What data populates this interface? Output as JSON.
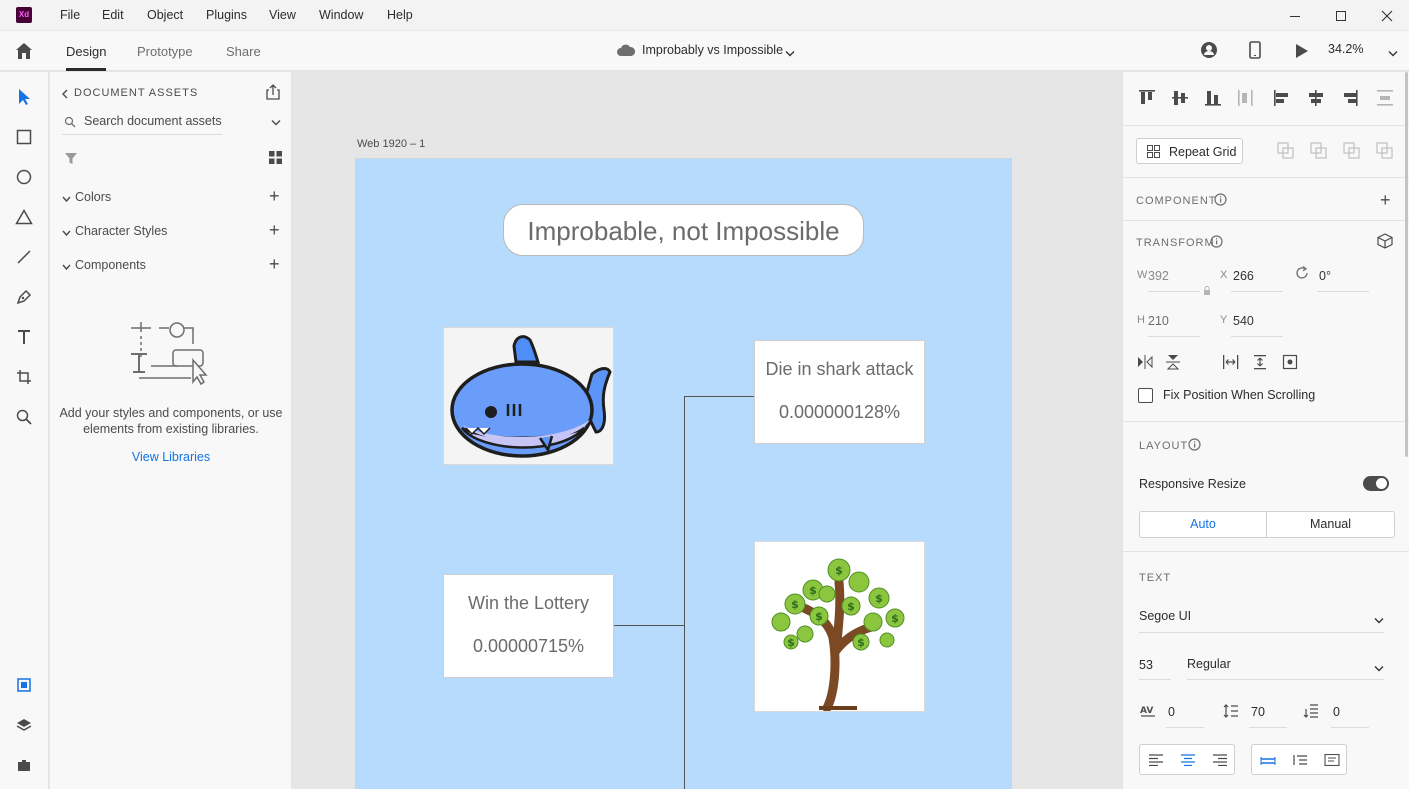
{
  "app": {
    "logo_text": "Xd"
  },
  "menu": [
    "File",
    "Edit",
    "Object",
    "Plugins",
    "View",
    "Window",
    "Help"
  ],
  "tabs": [
    "Design",
    "Prototype",
    "Share"
  ],
  "document": {
    "title": "Improbably vs Impossible",
    "zoom": "34.2%"
  },
  "assets": {
    "heading": "DOCUMENT ASSETS",
    "search_placeholder": "Search document assets",
    "sections": [
      "Colors",
      "Character Styles",
      "Components"
    ],
    "empty_message": "Add your styles and components, or use elements from existing libraries.",
    "libraries_link": "View Libraries"
  },
  "artboard": {
    "name": "Web 1920 – 1",
    "title": "Improbable, not Impossible",
    "cards": [
      {
        "label": "Die in shark attack",
        "value": "0.000000128%"
      },
      {
        "label": "Win the Lottery",
        "value": "0.00000715%"
      }
    ]
  },
  "properties": {
    "repeat_grid": "Repeat Grid",
    "component_title": "COMPONENT",
    "transform_title": "TRANSFORM",
    "w_label": "W",
    "w_value": "392",
    "h_label": "H",
    "h_value": "210",
    "x_label": "X",
    "x_value": "266",
    "y_label": "Y",
    "y_value": "540",
    "rotation": "0°",
    "fix_position": "Fix Position When Scrolling",
    "layout_title": "LAYOUT",
    "responsive_resize": "Responsive Resize",
    "resize_auto": "Auto",
    "resize_manual": "Manual",
    "text_title": "TEXT",
    "font_family": "Segoe UI",
    "font_size": "53",
    "font_weight": "Regular",
    "char_spacing": "0",
    "line_spacing": "70",
    "para_spacing": "0"
  },
  "colors": {
    "accent": "#1473e6",
    "artboard_bg": "#b6dbfd",
    "logo_bg": "#470137",
    "logo_fg": "#ff61f6"
  }
}
